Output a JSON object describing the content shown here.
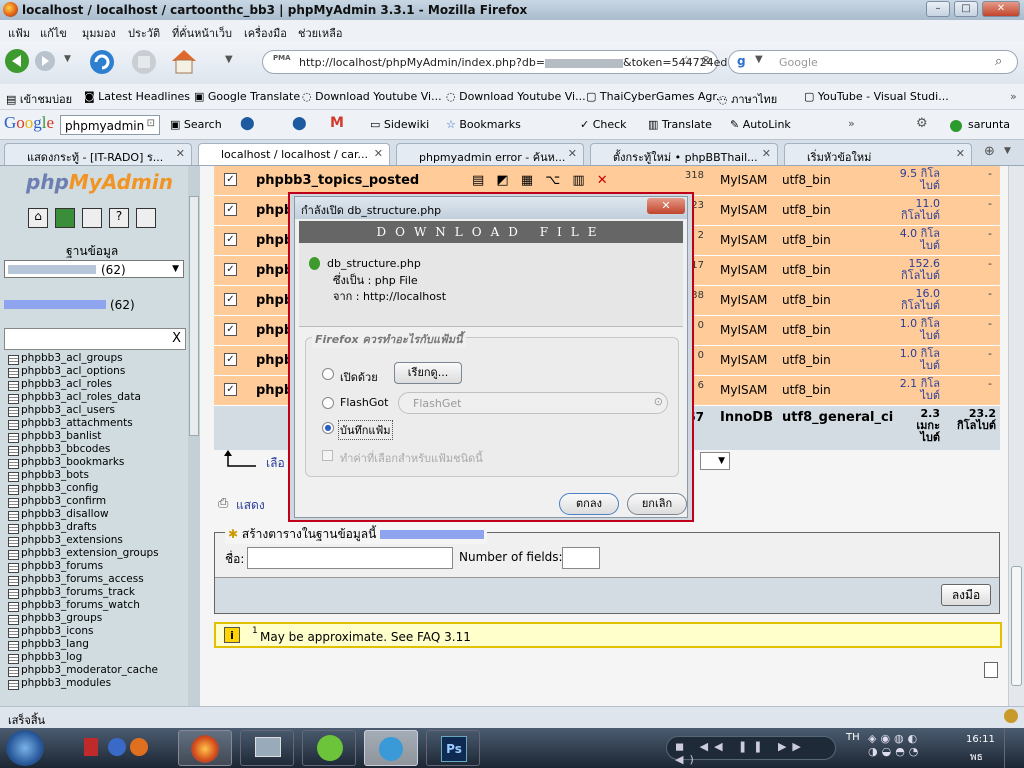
{
  "window": {
    "title": "localhost / localhost / cartoonthc_bb3 | phpMyAdmin 3.3.1 - Mozilla Firefox"
  },
  "menu": [
    "แฟ้ม",
    "แก้ไข",
    "มุมมอง",
    "ประวัติ",
    "ที่คั่นหน้าเว็บ",
    "เครื่องมือ",
    "ช่วยเหลือ"
  ],
  "nav": {
    "url": "http://localhost/phpMyAdmin/index.php?db=",
    "url_token": "&token=544724ed",
    "search_placeholder": "Google",
    "pma_label": "PMA"
  },
  "bookmarks": [
    "เข้าชมบ่อย",
    "Latest Headlines",
    "Google Translate",
    "Download Youtube Vi...",
    "Download Youtube Vi...",
    "ThaiCyberGames Agr...",
    "ภาษาไทย",
    "YouTube - Visual Studi..."
  ],
  "google_toolbar": {
    "search_value": "phpmyadmin",
    "items": [
      "Search",
      "Sidewiki",
      "Bookmarks",
      "Check",
      "Translate",
      "AutoLink"
    ],
    "user": "sarunta"
  },
  "tabs": [
    "แสดงกระทู้ - [IT-RADO] ร...",
    "localhost / localhost / car...",
    "phpmyadmin error - ค้นห...",
    "ตั้งกระทู้ใหม่ • phpBBThail...",
    "เริ่มหัวข้อใหม่"
  ],
  "sidebar": {
    "logo_php": "php",
    "logo_my": "MyAdmin",
    "db_label": "ฐานข้อมูล",
    "db_count": "(62)",
    "db_name_count": "(62)",
    "filter_clear": "X",
    "tables": [
      "phpbb3_acl_groups",
      "phpbb3_acl_options",
      "phpbb3_acl_roles",
      "phpbb3_acl_roles_data",
      "phpbb3_acl_users",
      "phpbb3_attachments",
      "phpbb3_banlist",
      "phpbb3_bbcodes",
      "phpbb3_bookmarks",
      "phpbb3_bots",
      "phpbb3_config",
      "phpbb3_confirm",
      "phpbb3_disallow",
      "phpbb3_drafts",
      "phpbb3_extensions",
      "phpbb3_extension_groups",
      "phpbb3_forums",
      "phpbb3_forums_access",
      "phpbb3_forums_track",
      "phpbb3_forums_watch",
      "phpbb3_groups",
      "phpbb3_icons",
      "phpbb3_lang",
      "phpbb3_log",
      "phpbb3_moderator_cache",
      "phpbb3_modules"
    ]
  },
  "rows": [
    {
      "name": "phpbb3_topics_posted",
      "recs": "318",
      "engine": "MyISAM",
      "coll": "utf8_bin",
      "size1": "9.5 กิโล",
      "size2": "ไบต์",
      "ovh": "-"
    },
    {
      "name": "phpb",
      "recs": "23",
      "engine": "MyISAM",
      "coll": "utf8_bin",
      "size1": "11.0",
      "size2": "กิโลไบต์",
      "ovh": "-"
    },
    {
      "name": "phpb",
      "recs": "2",
      "engine": "MyISAM",
      "coll": "utf8_bin",
      "size1": "4.0 กิโล",
      "size2": "ไบต์",
      "ovh": "-"
    },
    {
      "name": "phpb",
      "recs": "17",
      "engine": "MyISAM",
      "coll": "utf8_bin",
      "size1": "152.6",
      "size2": "กิโลไบต์",
      "ovh": "-"
    },
    {
      "name": "phpb",
      "recs": "38",
      "engine": "MyISAM",
      "coll": "utf8_bin",
      "size1": "16.0",
      "size2": "กิโลไบต์",
      "ovh": "-"
    },
    {
      "name": "phpb",
      "recs": "0",
      "engine": "MyISAM",
      "coll": "utf8_bin",
      "size1": "1.0 กิโล",
      "size2": "ไบต์",
      "ovh": "-"
    },
    {
      "name": "phpb",
      "recs": "0",
      "engine": "MyISAM",
      "coll": "utf8_bin",
      "size1": "1.0 กิโล",
      "size2": "ไบต์",
      "ovh": "-"
    },
    {
      "name": "phpb",
      "recs": "6",
      "engine": "MyISAM",
      "coll": "utf8_bin",
      "size1": "2.1 กิโล",
      "size2": "ไบต์",
      "ovh": "-"
    }
  ],
  "totals": {
    "recs": "67",
    "engine": "InnoDB",
    "coll": "utf8_general_ci",
    "size1": "2.3",
    "size2": "เมกะ",
    "size3": "ไบต์",
    "ovh1": "23.2",
    "ovh2": "กิโลไบต์"
  },
  "check_all": "เลือ",
  "print_view": "แสดง",
  "create": {
    "title": "สร้างตารางในฐานข้อมูลนี้",
    "name_label": "ชื่อ:",
    "fields_label": "Number of fields:",
    "go": "ลงมือ"
  },
  "notice": {
    "sup": "1",
    "text": "May be approximate. See FAQ 3.11"
  },
  "dialog": {
    "title": "กำลังเปิด db_structure.php",
    "banner": "DOWNLOAD FILE",
    "file": "db_structure.php",
    "type_label": "ซึ่งเป็น : php File",
    "from_label": "จาก : http://localhost",
    "question": "Firefox ควรทำอะไรกับแฟ้มนี้",
    "open_with": "เปิดด้วย",
    "browse": "เรียกดู...",
    "flashgot": "FlashGot",
    "flashget": "FlashGet",
    "save": "บันทึกแฟ้ม",
    "remember": "ทำค่าที่เลือกสำหรับแฟ้มชนิดนี้",
    "ok": "ตกลง",
    "cancel": "ยกเลิก"
  },
  "status": "เสร็จสิ้น",
  "taskbar": {
    "clock": "16:11",
    "day": "พธ",
    "ps": "Ps"
  },
  "colors": {
    "row_bg": "#ffcc99",
    "highlight": "#c00018"
  }
}
